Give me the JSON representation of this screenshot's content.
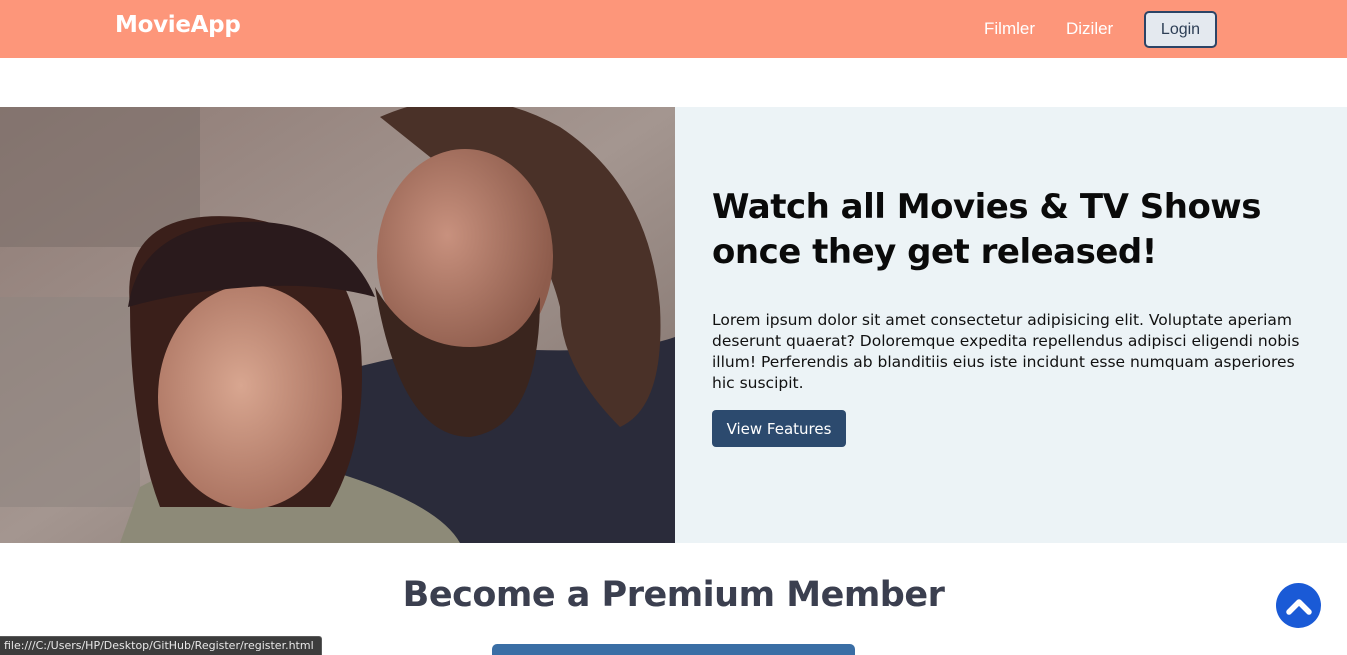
{
  "navbar": {
    "brand": "MovieApp",
    "links": [
      "Filmler",
      "Diziler"
    ],
    "login_label": "Login"
  },
  "hero": {
    "title": "Watch all Movies & TV Shows once they get released!",
    "text": "Lorem ipsum dolor sit amet consectetur adipisicing elit. Voluptate aperiam deserunt quaerat? Doloremque expedita repellendus adipisci eligendi nobis illum! Perferendis ab blanditiis eius iste incidunt esse numquam asperiores hic suscipit.",
    "button_label": "View Features"
  },
  "premium": {
    "title": "Become a Premium Member"
  },
  "status_bar": {
    "url": "file:///C:/Users/HP/Desktop/GitHub/Register/register.html"
  },
  "icons": {
    "scroll_top": "chevron-up-icon"
  },
  "colors": {
    "navbar": "#fd967a",
    "hero_background": "#ecf3f6",
    "button": "#2c4a6e",
    "scroll_top": "#1a5ad6"
  }
}
